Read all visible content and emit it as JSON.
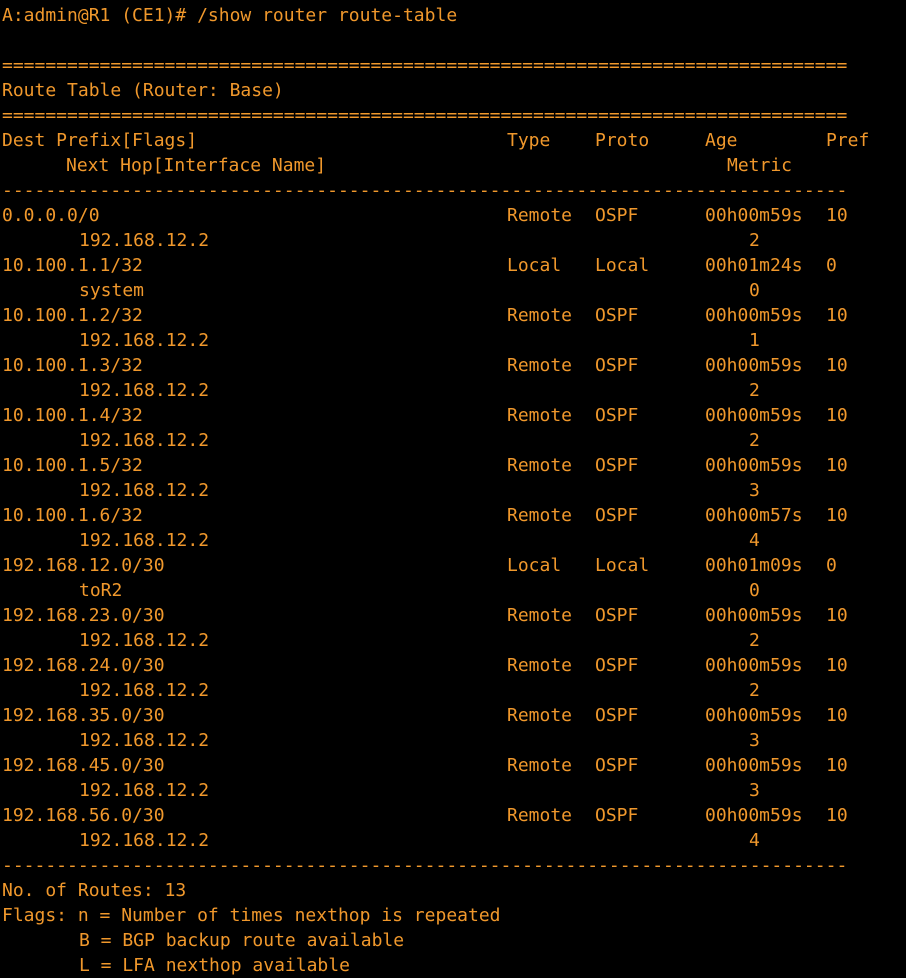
{
  "prompt": "A:admin@R1 (CE1)# /show router route-table",
  "rule_double": "==============================================================================",
  "rule_single": "------------------------------------------------------------------------------",
  "table_title": "Route Table (Router: Base)",
  "columns": {
    "dest_prefix": "Dest Prefix[Flags]",
    "type": "Type",
    "proto": "Proto",
    "age": "Age",
    "pref": "Pref",
    "next_hop": "Next Hop[Interface Name]",
    "metric": "Metric"
  },
  "routes": [
    {
      "prefix": "0.0.0.0/0",
      "type": "Remote",
      "proto": "OSPF",
      "age": "00h00m59s",
      "pref": "10",
      "next_hop": "192.168.12.2",
      "metric": "2"
    },
    {
      "prefix": "10.100.1.1/32",
      "type": "Local",
      "proto": "Local",
      "age": "00h01m24s",
      "pref": "0",
      "next_hop": "system",
      "metric": "0"
    },
    {
      "prefix": "10.100.1.2/32",
      "type": "Remote",
      "proto": "OSPF",
      "age": "00h00m59s",
      "pref": "10",
      "next_hop": "192.168.12.2",
      "metric": "1"
    },
    {
      "prefix": "10.100.1.3/32",
      "type": "Remote",
      "proto": "OSPF",
      "age": "00h00m59s",
      "pref": "10",
      "next_hop": "192.168.12.2",
      "metric": "2"
    },
    {
      "prefix": "10.100.1.4/32",
      "type": "Remote",
      "proto": "OSPF",
      "age": "00h00m59s",
      "pref": "10",
      "next_hop": "192.168.12.2",
      "metric": "2"
    },
    {
      "prefix": "10.100.1.5/32",
      "type": "Remote",
      "proto": "OSPF",
      "age": "00h00m59s",
      "pref": "10",
      "next_hop": "192.168.12.2",
      "metric": "3"
    },
    {
      "prefix": "10.100.1.6/32",
      "type": "Remote",
      "proto": "OSPF",
      "age": "00h00m57s",
      "pref": "10",
      "next_hop": "192.168.12.2",
      "metric": "4"
    },
    {
      "prefix": "192.168.12.0/30",
      "type": "Local",
      "proto": "Local",
      "age": "00h01m09s",
      "pref": "0",
      "next_hop": "toR2",
      "metric": "0"
    },
    {
      "prefix": "192.168.23.0/30",
      "type": "Remote",
      "proto": "OSPF",
      "age": "00h00m59s",
      "pref": "10",
      "next_hop": "192.168.12.2",
      "metric": "2"
    },
    {
      "prefix": "192.168.24.0/30",
      "type": "Remote",
      "proto": "OSPF",
      "age": "00h00m59s",
      "pref": "10",
      "next_hop": "192.168.12.2",
      "metric": "2"
    },
    {
      "prefix": "192.168.35.0/30",
      "type": "Remote",
      "proto": "OSPF",
      "age": "00h00m59s",
      "pref": "10",
      "next_hop": "192.168.12.2",
      "metric": "3"
    },
    {
      "prefix": "192.168.45.0/30",
      "type": "Remote",
      "proto": "OSPF",
      "age": "00h00m59s",
      "pref": "10",
      "next_hop": "192.168.12.2",
      "metric": "3"
    },
    {
      "prefix": "192.168.56.0/30",
      "type": "Remote",
      "proto": "OSPF",
      "age": "00h00m59s",
      "pref": "10",
      "next_hop": "192.168.12.2",
      "metric": "4"
    }
  ],
  "footer": {
    "route_count": "No. of Routes: 13",
    "flags_n": "Flags: n = Number of times nexthop is repeated",
    "flags_b": "B = BGP backup route available",
    "flags_l": "L = LFA nexthop available"
  },
  "colors": {
    "background": "#000000",
    "text": "#f0982c"
  }
}
